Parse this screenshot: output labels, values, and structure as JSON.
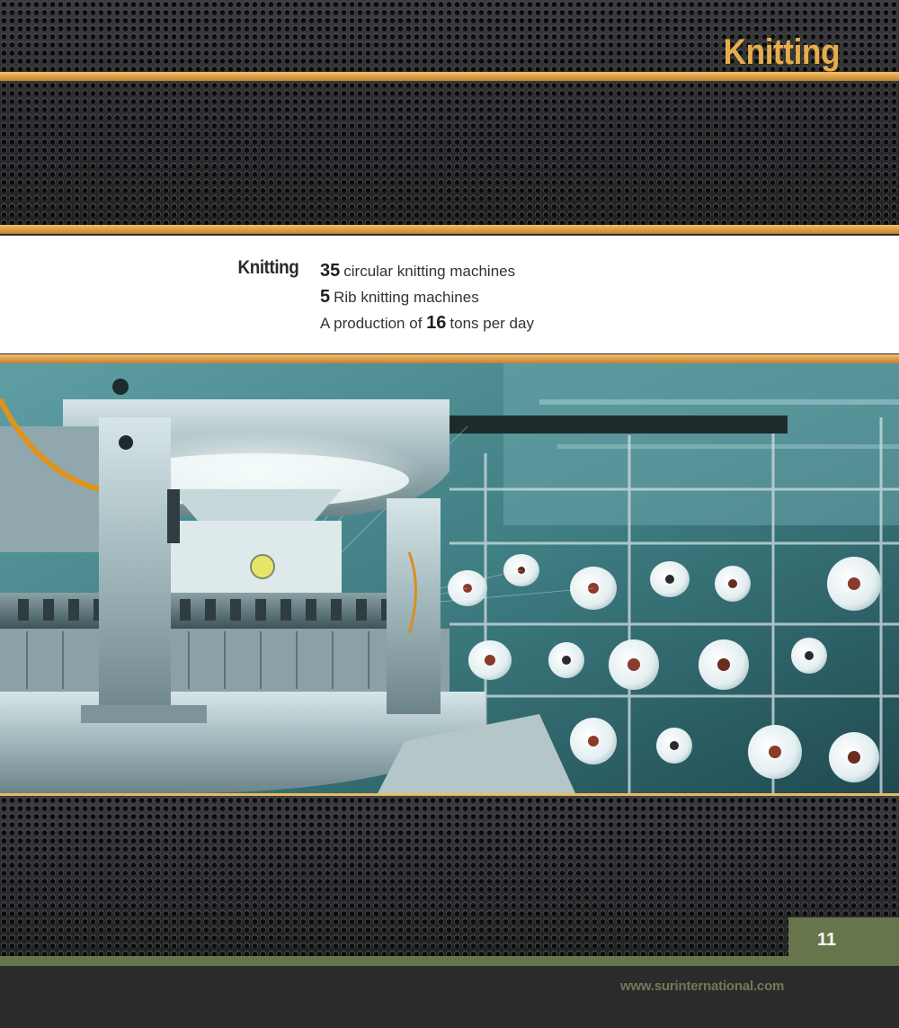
{
  "header": {
    "title": "Knitting"
  },
  "info": {
    "label": "Knitting",
    "lines": [
      {
        "pre": "",
        "num": "35",
        "post": "circular knitting machines"
      },
      {
        "pre": "",
        "num": "5",
        "post": "Rib knitting machines"
      },
      {
        "pre": "A production of ",
        "num": "16",
        "post": "tons per day"
      }
    ]
  },
  "footer": {
    "page_number": "11",
    "website": "www.surinternational.com"
  },
  "colors": {
    "gold_accent": "#dca14a",
    "olive_accent": "#66754b",
    "dark_background": "#2d2d2e"
  }
}
